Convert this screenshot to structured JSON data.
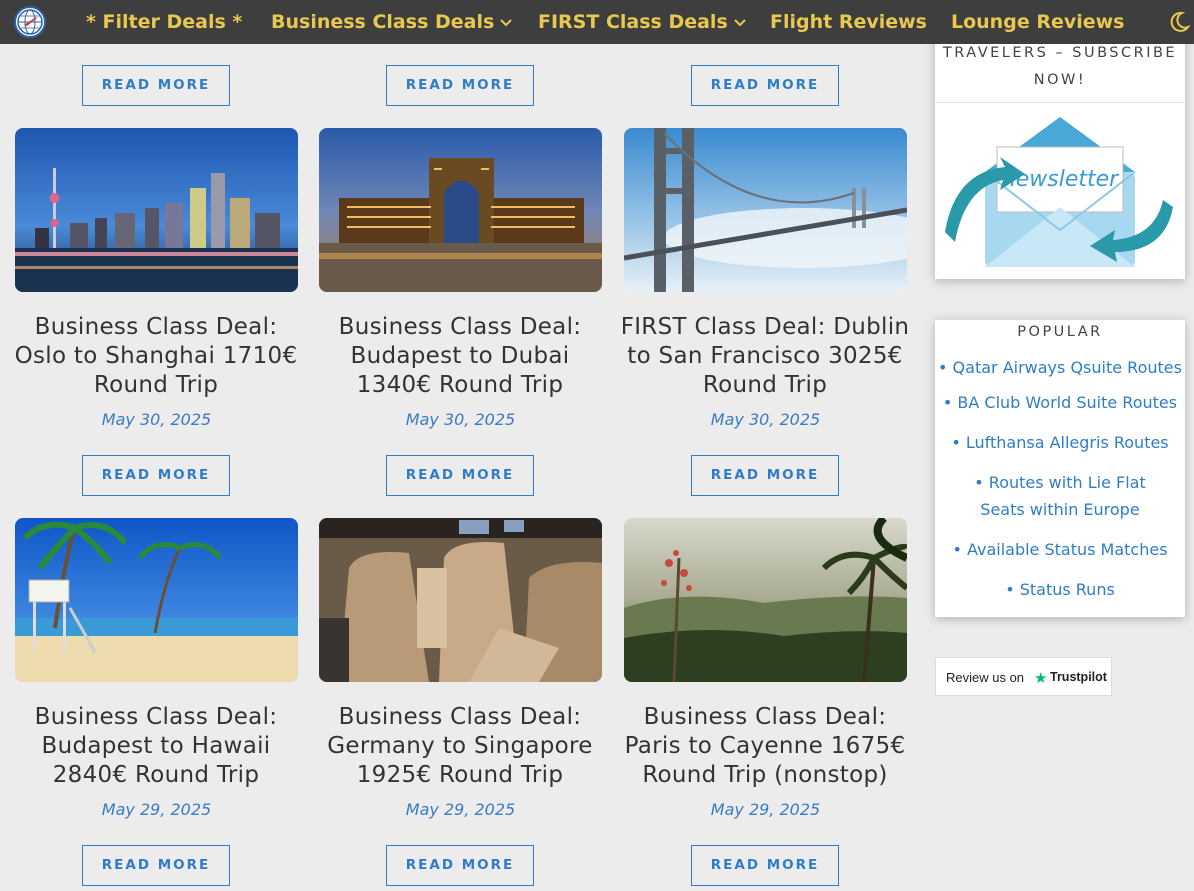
{
  "nav": {
    "items": [
      {
        "label": "* Filter Deals *",
        "has_dropdown": false
      },
      {
        "label": "Business Class Deals",
        "has_dropdown": true
      },
      {
        "label": "FIRST Class Deals",
        "has_dropdown": true
      },
      {
        "label": "Flight Reviews",
        "has_dropdown": false
      },
      {
        "label": "Lounge Reviews",
        "has_dropdown": false
      }
    ],
    "theme_icon": "moon-icon",
    "colors": {
      "bar": "#3e3e3e",
      "link": "#e8c84e"
    }
  },
  "posts": {
    "read_more_label": "READ MORE",
    "rows": [
      {
        "cards": [
          {
            "title": "Business Class Deal: Oslo to Shanghai 1710€ Round Trip",
            "date": "May 30, 2025",
            "image": "shanghai-skyline"
          },
          {
            "title": "Business Class Deal: Budapest to Dubai 1340€ Round Trip",
            "date": "May 30, 2025",
            "image": "atlantis-dubai"
          },
          {
            "title": "FIRST Class Deal: Dublin to San Francisco 3025€ Round Trip",
            "date": "May 30, 2025",
            "image": "golden-gate-bridge"
          }
        ]
      },
      {
        "cards": [
          {
            "title": "Business Class Deal: Budapest to Hawaii 2840€ Round Trip",
            "date": "May 29, 2025",
            "image": "hawaii-beach"
          },
          {
            "title": "Business Class Deal: Germany to Singapore 1925€ Round Trip",
            "date": "May 29, 2025",
            "image": "business-class-seat"
          },
          {
            "title": "Business Class Deal: Paris to Cayenne 1675€ Round Trip (nonstop)",
            "date": "May 29, 2025",
            "image": "rainforest"
          }
        ]
      }
    ]
  },
  "sidebar": {
    "subscribe_text": "TRAVELERS – SUBSCRIBE NOW!",
    "newsletter_label": "newsletter",
    "popular": {
      "title": "POPULAR",
      "links": [
        "• Qatar Airways Qsuite Routes",
        "• BA Club World Suite Routes",
        "• Lufthansa Allegris Routes",
        "• Routes with Lie Flat Seats within Europe",
        "• Available Status Matches",
        "• Status Runs"
      ]
    },
    "trustpilot": {
      "prefix": "Review us on",
      "brand": "Trustpilot"
    }
  },
  "colors": {
    "accent": "#2f7dc6",
    "page_bg": "#ececec"
  }
}
